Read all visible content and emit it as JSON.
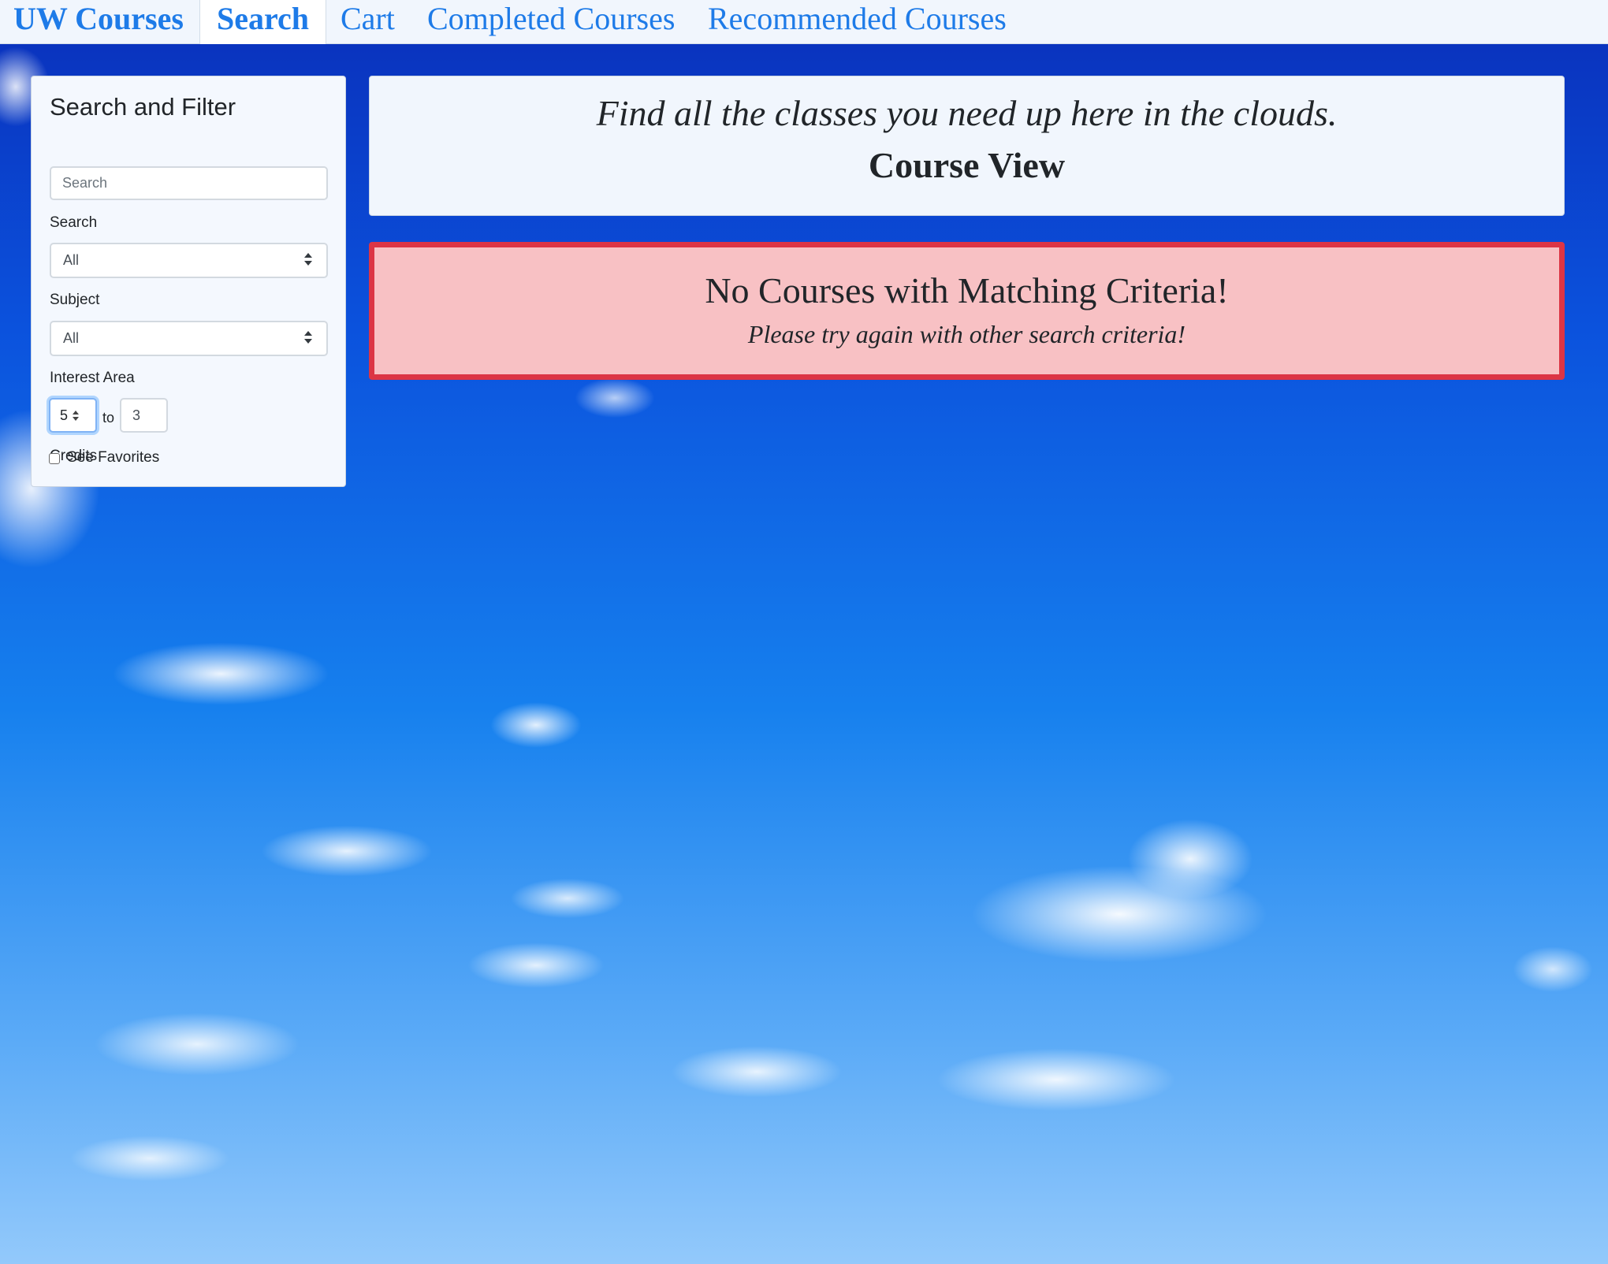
{
  "nav": {
    "brand": "UW Courses",
    "tabs": [
      {
        "label": "Search",
        "active": true
      },
      {
        "label": "Cart",
        "active": false
      },
      {
        "label": "Completed Courses",
        "active": false
      },
      {
        "label": "Recommended Courses",
        "active": false
      }
    ]
  },
  "sidebar": {
    "title": "Search and Filter",
    "search": {
      "label": "Search",
      "placeholder": "Search",
      "value": ""
    },
    "subject": {
      "label": "Subject",
      "selected": "All"
    },
    "interest_area": {
      "label": "Interest Area",
      "selected": "All"
    },
    "credits": {
      "label": "Credits",
      "min": "5",
      "separator": "to",
      "max": "3"
    },
    "favorites": {
      "label": "See Favorites",
      "checked": false
    }
  },
  "header": {
    "tagline": "Find all the classes you need up here in the clouds.",
    "title": "Course View"
  },
  "alert": {
    "title": "No Courses with Matching Criteria!",
    "message": "Please try again with other search criteria!"
  },
  "colors": {
    "link": "#1e7be8",
    "alert_border": "#dc3545",
    "alert_background": "#f8c1c4",
    "sky_top": "#0a2fba",
    "sky_bottom": "#93c9fb"
  }
}
